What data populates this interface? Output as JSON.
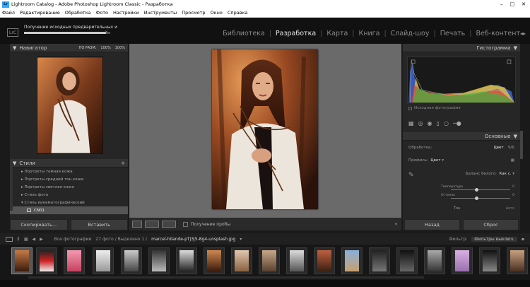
{
  "window": {
    "title": "Lightroom Catalog - Adobe Photoshop Lightroom Classic - Разработка",
    "logo": "Lr",
    "controls": [
      "–",
      "□",
      "✕"
    ]
  },
  "menu": [
    "Файл",
    "Редактирование",
    "Обработка",
    "Фото",
    "Настройки",
    "Инструменты",
    "Просмотр",
    "Окно",
    "Справка"
  ],
  "header": {
    "logo": "LrC",
    "import_status": "Получение исходных предварительных и",
    "progress": 0.95,
    "cancel": "✕"
  },
  "modules": [
    {
      "label": "Библиотека",
      "active": false
    },
    {
      "label": "Разработка",
      "active": true
    },
    {
      "label": "Карта",
      "active": false
    },
    {
      "label": "Книга",
      "active": false
    },
    {
      "label": "Слайд-шоу",
      "active": false
    },
    {
      "label": "Печать",
      "active": false
    },
    {
      "label": "Веб-контент",
      "active": false
    }
  ],
  "navigator": {
    "title": "Навигатор",
    "fit": "ПО РАЗМ.",
    "zoom1": "100%",
    "zoom2": "100%"
  },
  "presets": {
    "title": "Стили",
    "add": "+",
    "items": [
      {
        "label": "Портреты темная кожа",
        "selected": false
      },
      {
        "label": "Портреты средний тон кожи",
        "selected": false
      },
      {
        "label": "Портреты светлая кожа",
        "selected": false
      },
      {
        "label": "Стиль фото",
        "selected": false
      },
      {
        "label": "Стиль кинематографический",
        "selected": false
      },
      {
        "label": "CN01",
        "selected": true
      }
    ]
  },
  "left_buttons": {
    "copy": "Скопировать...",
    "paste": "Вставить"
  },
  "toolbar": {
    "soft_proof": "Получение пробы"
  },
  "histogram": {
    "title": "Гистограмма",
    "original": "Исходная фотография"
  },
  "basic": {
    "title": "Основные",
    "treatment_label": "Обработка:",
    "treatment_value": "Цвет",
    "bw": "Ч/Б",
    "profile_label": "Профиль:",
    "profile_value": "Цвет",
    "wb_label": "Баланс белого:",
    "wb_value": "Как с.",
    "temp_label": "Температура",
    "temp_value": "0",
    "tint_label": "Оттенок",
    "tint_value": "0",
    "tone_label": "Тон",
    "tone_auto": "Авто"
  },
  "right_buttons": {
    "prev": "Назад",
    "reset": "Сброс"
  },
  "filmstrip": {
    "source": "Все фотографии",
    "count": "27 фото / Выделено 1 /",
    "file": "marcel-hilande-pTj3j5-8g4-unsplash.jpg",
    "filter_label": "Фильтр:",
    "filter_value": "Фильтры выключ."
  },
  "colors": {
    "accent": "#31a8ff",
    "bg": "#1a1a1a",
    "panel": "#262626"
  }
}
